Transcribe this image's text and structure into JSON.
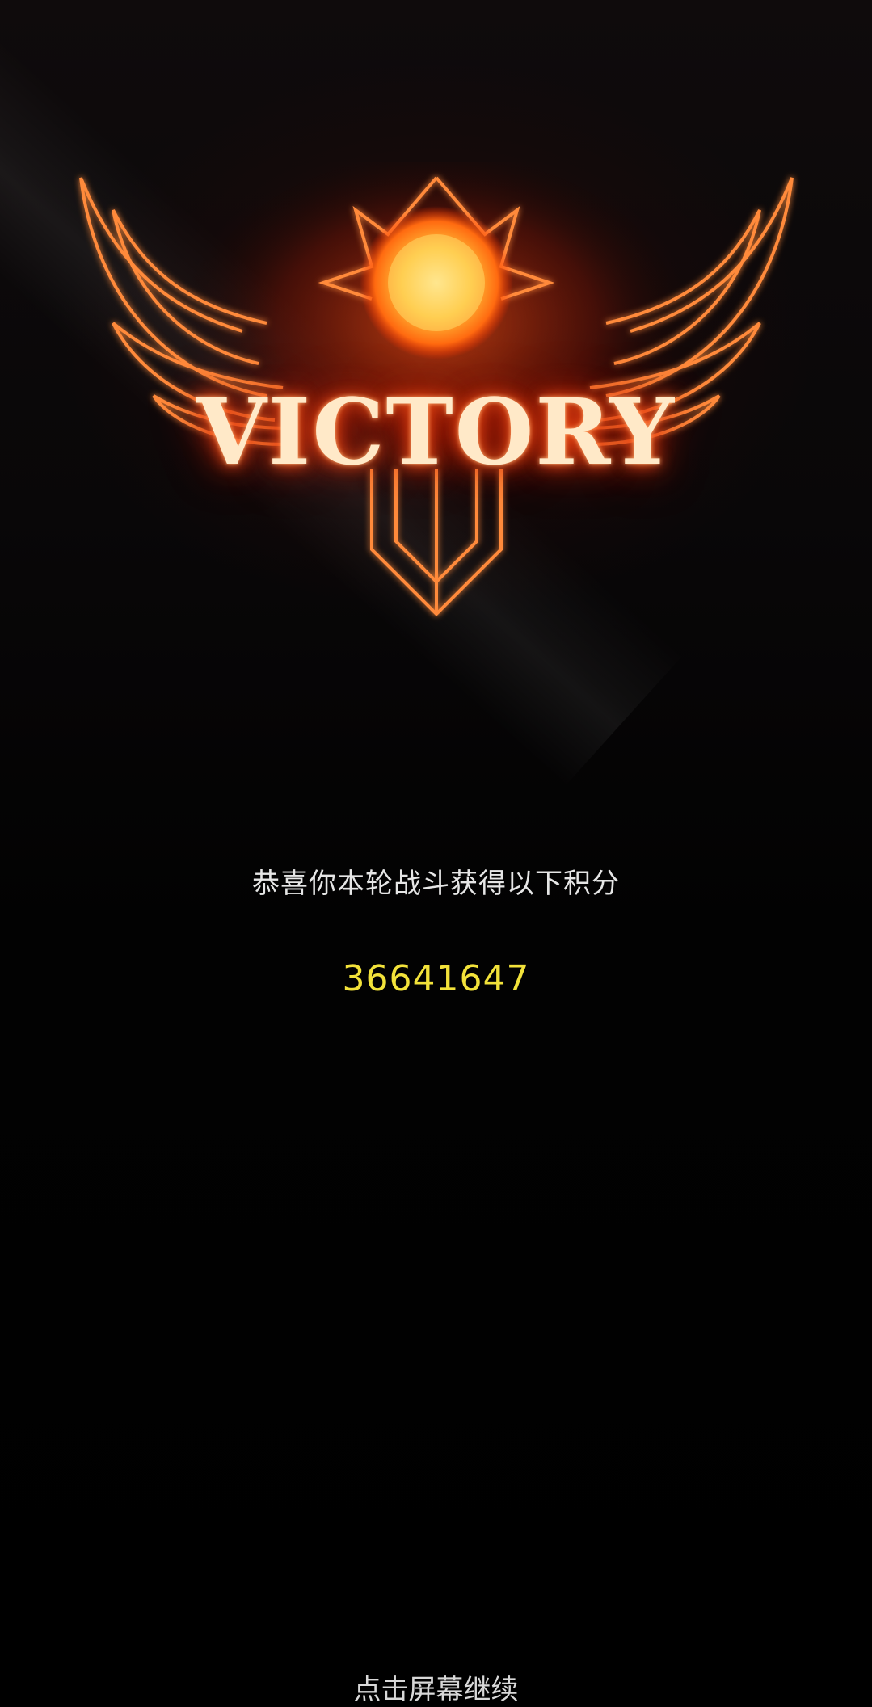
{
  "victory": {
    "title": "VICTORY"
  },
  "result": {
    "message": "恭喜你本轮战斗获得以下积分",
    "score": "36641647"
  },
  "footer": {
    "continue_label": "点击屏幕继续"
  },
  "colors": {
    "background": "#000000",
    "glow": "#ff4a10",
    "score": "#f2e23a",
    "text": "#e6e6e6"
  }
}
